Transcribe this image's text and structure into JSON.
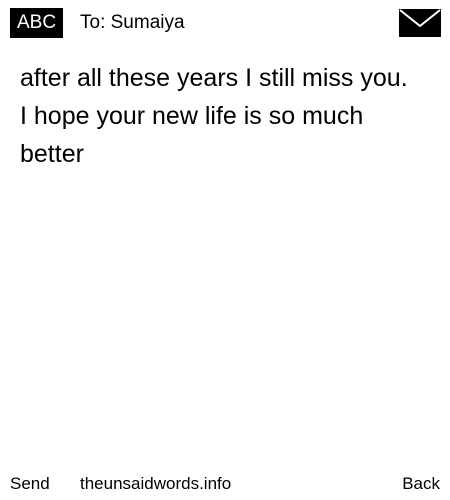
{
  "header": {
    "badge": "ABC",
    "to_text": "To: Sumaiya",
    "envelope_icon": "envelope-icon"
  },
  "message": {
    "text": "after all these years I still miss you. I hope your new life is so much better"
  },
  "footer": {
    "send_label": "Send",
    "site_label": "theunsaidwords.info",
    "back_label": "Back"
  }
}
